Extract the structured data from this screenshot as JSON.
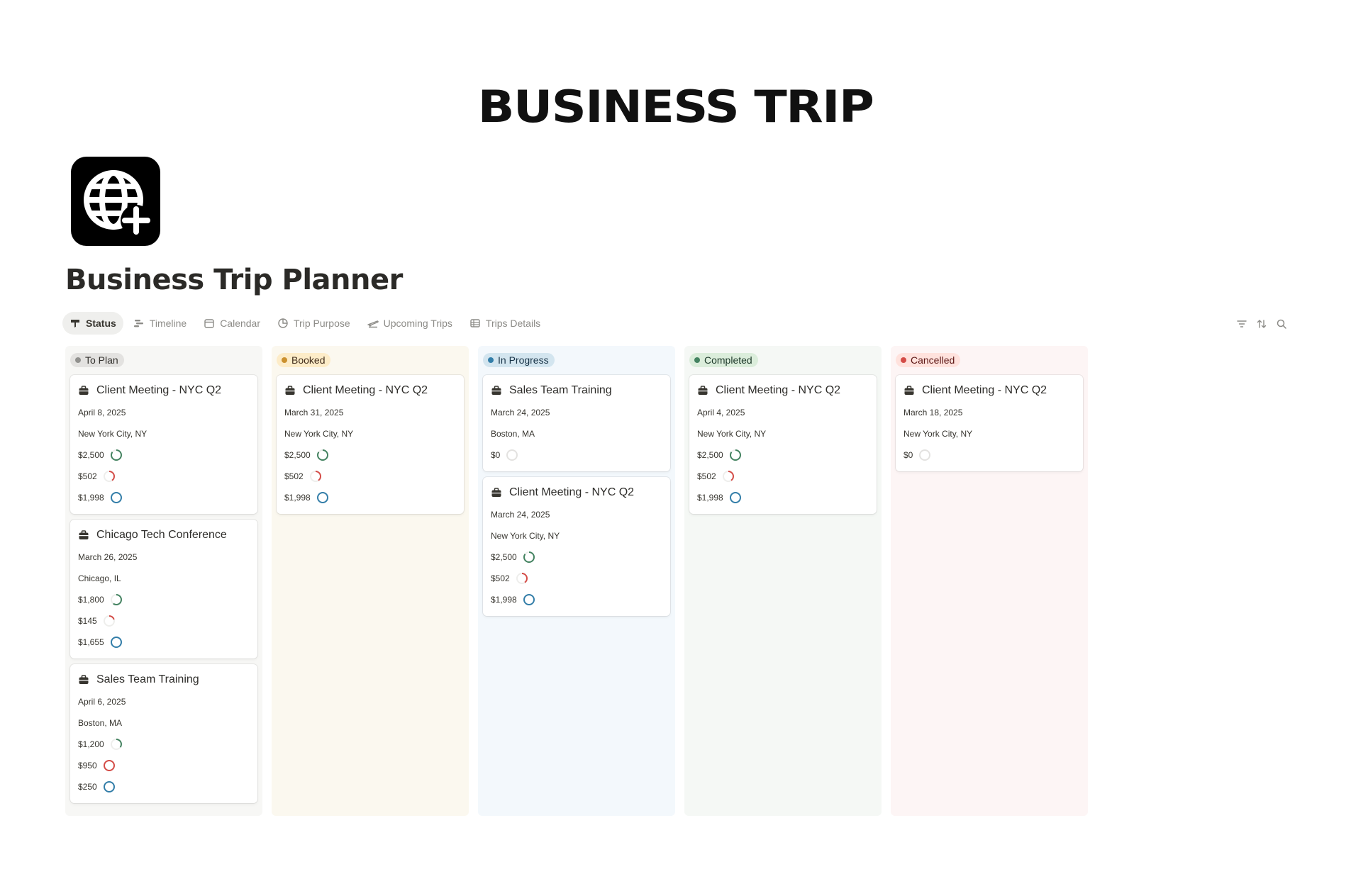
{
  "banner": {
    "title": "BUSINESS TRIP"
  },
  "page": {
    "title": "Business Trip Planner",
    "icon": "globe-plus-icon"
  },
  "tabs": [
    {
      "label": "Status",
      "icon": "board-icon",
      "active": true
    },
    {
      "label": "Timeline",
      "icon": "timeline-icon",
      "active": false
    },
    {
      "label": "Calendar",
      "icon": "calendar-icon",
      "active": false
    },
    {
      "label": "Trip Purpose",
      "icon": "pie-icon",
      "active": false
    },
    {
      "label": "Upcoming Trips",
      "icon": "plane-icon",
      "active": false
    },
    {
      "label": "Trips Details",
      "icon": "table-icon",
      "active": false
    }
  ],
  "tools": [
    {
      "name": "filter-icon"
    },
    {
      "name": "sort-icon"
    },
    {
      "name": "search-icon"
    }
  ],
  "colors": {
    "green": "#448361",
    "red": "#d44c47",
    "blue": "#337ea9",
    "gray": "#e3e2e0"
  },
  "columns": [
    {
      "label": "To Plan",
      "bg": "#f7f7f5",
      "pill_bg": "#e3e2e0",
      "pill_fg": "#32302c",
      "dot": "#91918e",
      "cards": [
        {
          "title": "Client Meeting - NYC Q2",
          "date": "April 8, 2025",
          "location": "New York City, NY",
          "amounts": [
            {
              "value": "$2,500",
              "progress": 0.85,
              "color": "green"
            },
            {
              "value": "$502",
              "progress": 0.4,
              "color": "red"
            },
            {
              "value": "$1,998",
              "progress": 1.0,
              "color": "blue"
            }
          ]
        },
        {
          "title": "Chicago Tech Conference",
          "date": "March 26, 2025",
          "location": "Chicago, IL",
          "amounts": [
            {
              "value": "$1,800",
              "progress": 0.6,
              "color": "green"
            },
            {
              "value": "$145",
              "progress": 0.2,
              "color": "red"
            },
            {
              "value": "$1,655",
              "progress": 1.0,
              "color": "blue"
            }
          ]
        },
        {
          "title": "Sales Team Training",
          "date": "April 6, 2025",
          "location": "Boston, MA",
          "amounts": [
            {
              "value": "$1,200",
              "progress": 0.35,
              "color": "green"
            },
            {
              "value": "$950",
              "progress": 1.0,
              "color": "red"
            },
            {
              "value": "$250",
              "progress": 1.0,
              "color": "blue"
            }
          ]
        }
      ]
    },
    {
      "label": "Booked",
      "bg": "#fbf8ef",
      "pill_bg": "#fdecc8",
      "pill_fg": "#402c1b",
      "dot": "#cb912f",
      "cards": [
        {
          "title": "Client Meeting - NYC Q2",
          "date": "March 31, 2025",
          "location": "New York City, NY",
          "amounts": [
            {
              "value": "$2,500",
              "progress": 0.85,
              "color": "green"
            },
            {
              "value": "$502",
              "progress": 0.4,
              "color": "red"
            },
            {
              "value": "$1,998",
              "progress": 1.0,
              "color": "blue"
            }
          ]
        }
      ]
    },
    {
      "label": "In Progress",
      "bg": "#f3f8fc",
      "pill_bg": "#d3e5ef",
      "pill_fg": "#183347",
      "dot": "#337ea9",
      "cards": [
        {
          "title": "Sales Team Training",
          "date": "March 24, 2025",
          "location": "Boston, MA",
          "amounts": [
            {
              "value": "$0",
              "progress": 0,
              "color": "gray"
            }
          ]
        },
        {
          "title": "Client Meeting - NYC Q2",
          "date": "March 24, 2025",
          "location": "New York City, NY",
          "amounts": [
            {
              "value": "$2,500",
              "progress": 0.85,
              "color": "green"
            },
            {
              "value": "$502",
              "progress": 0.4,
              "color": "red"
            },
            {
              "value": "$1,998",
              "progress": 1.0,
              "color": "blue"
            }
          ]
        }
      ]
    },
    {
      "label": "Completed",
      "bg": "#f5f8f5",
      "pill_bg": "#dbeddb",
      "pill_fg": "#1c3829",
      "dot": "#448361",
      "cards": [
        {
          "title": "Client Meeting - NYC Q2",
          "date": "April 4, 2025",
          "location": "New York City, NY",
          "amounts": [
            {
              "value": "$2,500",
              "progress": 0.85,
              "color": "green"
            },
            {
              "value": "$502",
              "progress": 0.4,
              "color": "red"
            },
            {
              "value": "$1,998",
              "progress": 1.0,
              "color": "blue"
            }
          ]
        }
      ]
    },
    {
      "label": "Cancelled",
      "bg": "#fdf5f5",
      "pill_bg": "#ffe2dd",
      "pill_fg": "#5d1715",
      "dot": "#d44c47",
      "cards": [
        {
          "title": "Client Meeting - NYC Q2",
          "date": "March 18, 2025",
          "location": "New York City, NY",
          "amounts": [
            {
              "value": "$0",
              "progress": 0,
              "color": "gray"
            }
          ]
        }
      ]
    }
  ]
}
